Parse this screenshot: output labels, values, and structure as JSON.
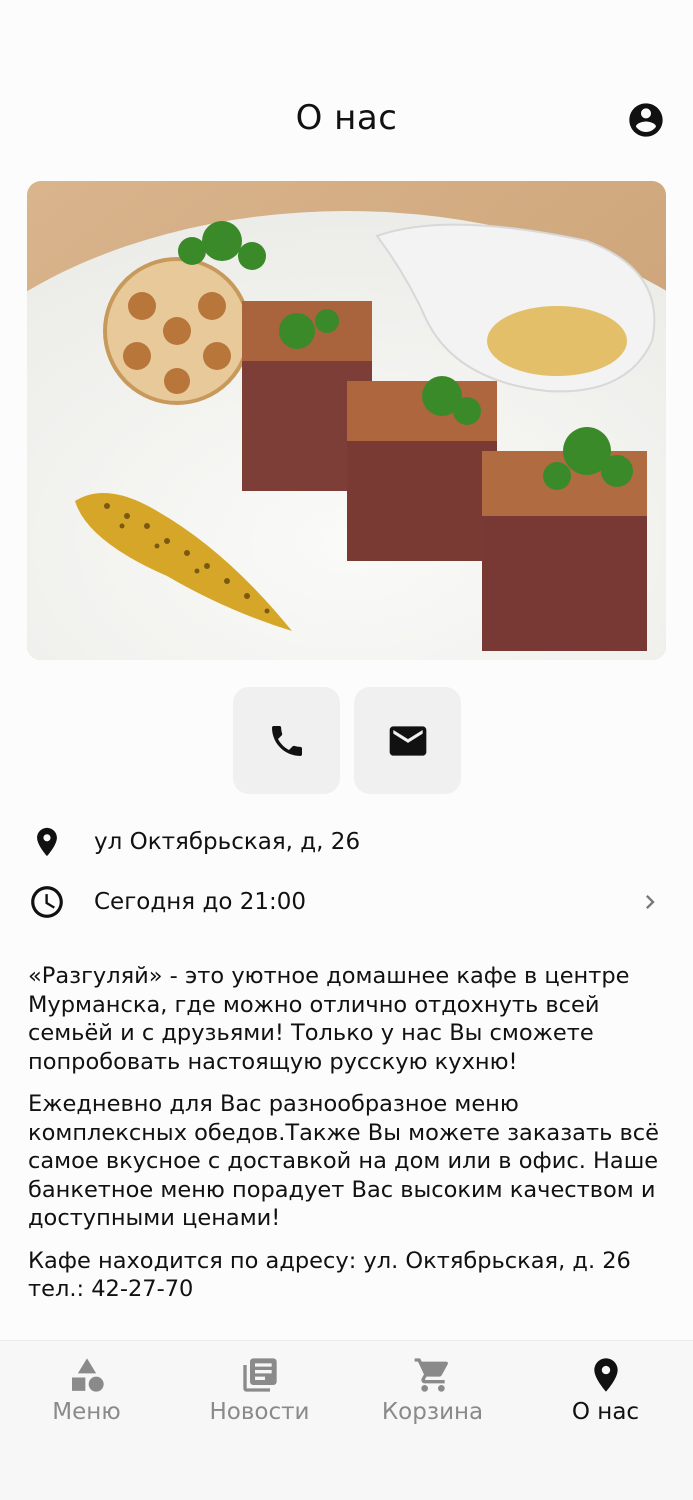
{
  "header": {
    "title": "О нас"
  },
  "icons": {
    "profile": "account-circle-icon",
    "phone": "phone-icon",
    "email": "mail-icon",
    "location": "map-pin-icon",
    "hours": "clock-icon",
    "chevron": "chevron-right-icon"
  },
  "hero": {
    "alt": "Блюдо ресторана"
  },
  "info": {
    "address": "ул Октябрьская, д, 26",
    "hours": "Сегодня до 21:00"
  },
  "about": {
    "paragraphs": [
      "«Разгуляй» - это уютное домашнее кафе в центре Мурманска, где можно отлично отдохнуть всей семьёй и с друзьями! Только у нас Вы сможете попробовать настоящую русскую кухню!",
      "Ежедневно для Вас разнообразное меню комплексных обедов.Также Вы можете заказать всё самое вкусное с доставкой на дом или в офис. Наше банкетное меню порадует Вас высоким качеством и доступными ценами!",
      "Кафе находится по адресу: ул. Октябрьская, д. 26 тел.: 42-27-70"
    ]
  },
  "tabbar": {
    "tabs": [
      {
        "label": "Меню",
        "icon": "shapes-icon",
        "active": false
      },
      {
        "label": "Новости",
        "icon": "newspaper-icon",
        "active": false
      },
      {
        "label": "Корзина",
        "icon": "cart-icon",
        "active": false
      },
      {
        "label": "О нас",
        "icon": "map-pin-icon",
        "active": true
      }
    ]
  },
  "colors": {
    "active": "#111111",
    "inactive": "#8a8a8a",
    "button_bg": "#f0f0f0"
  }
}
